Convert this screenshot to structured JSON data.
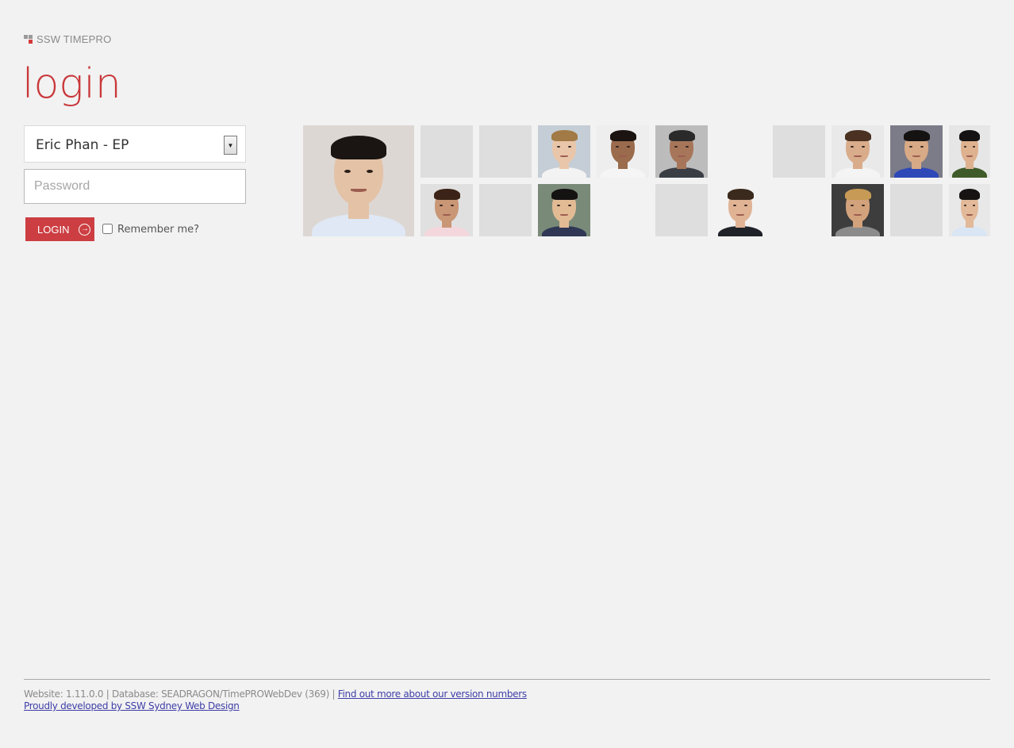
{
  "brand": {
    "name": "SSW TIMEPRO",
    "accent": "#c9383b"
  },
  "page": {
    "title": "login"
  },
  "form": {
    "user_select": {
      "selected": "Eric Phan - EP"
    },
    "password": {
      "placeholder": "Password",
      "value": ""
    },
    "login_button": {
      "label": "LOGIN",
      "icon": "arrow-circle-right-icon"
    },
    "remember": {
      "label": "Remember me?",
      "checked": false
    }
  },
  "avatars": [
    {
      "id": "featured",
      "kind": "photo",
      "skin": "#e4c2a6",
      "hair": "#1a1412",
      "shirt": "#dfe8f4",
      "bg": "#ddd7d4"
    },
    {
      "id": "r1c1",
      "kind": "empty"
    },
    {
      "id": "r1c2",
      "kind": "empty"
    },
    {
      "id": "r1c3",
      "kind": "photo",
      "skin": "#e9c6aa",
      "hair": "#a27a45",
      "shirt": "#f3f3f3",
      "bg": "#c5ced6"
    },
    {
      "id": "r1c4",
      "kind": "photo",
      "skin": "#9a6b4c",
      "hair": "#1c1410",
      "shirt": "#f5f5f5",
      "bg": "#eeeeee"
    },
    {
      "id": "r1c5",
      "kind": "photo",
      "skin": "#a7765a",
      "hair": "#2a2a2a",
      "shirt": "#3a3d44",
      "bg": "#bcbcbc"
    },
    {
      "id": "r1c7",
      "kind": "empty"
    },
    {
      "id": "r1c8",
      "kind": "photo",
      "skin": "#d9ac8c",
      "hair": "#4a3122",
      "shirt": "#f4f4f4",
      "bg": "#e9e9e9"
    },
    {
      "id": "r1c9",
      "kind": "photo",
      "skin": "#d8aa86",
      "hair": "#151212",
      "shirt": "#2e48b8",
      "bg": "#7c7c88"
    },
    {
      "id": "r1c10",
      "kind": "photo",
      "skin": "#deb18f",
      "hair": "#141212",
      "shirt": "#3f5b2a",
      "bg": "#e6e6e6"
    },
    {
      "id": "r2c1",
      "kind": "photo",
      "skin": "#c99676",
      "hair": "#3b2417",
      "shirt": "#f4d7dc",
      "bg": "#e0e0e0"
    },
    {
      "id": "r2c2",
      "kind": "empty"
    },
    {
      "id": "r2c3",
      "kind": "photo",
      "skin": "#e2bb95",
      "hair": "#151212",
      "shirt": "#2f3755",
      "bg": "#7a8a78"
    },
    {
      "id": "r2c5",
      "kind": "empty"
    },
    {
      "id": "r2c6",
      "kind": "photo",
      "skin": "#e0b395",
      "hair": "#3a2a1e",
      "shirt": "#1f2329",
      "bg": "#f2f2f2"
    },
    {
      "id": "r2c8",
      "kind": "photo",
      "skin": "#d2a27c",
      "hair": "#c79a55",
      "shirt": "#8b8b8b",
      "bg": "#3d3d3d"
    },
    {
      "id": "r2c9",
      "kind": "empty"
    },
    {
      "id": "r2c10",
      "kind": "photo",
      "skin": "#e2b999",
      "hair": "#171313",
      "shirt": "#dbe6f4",
      "bg": "#e8e8e8"
    }
  ],
  "footer": {
    "version_text": "Website: 1.11.0.0 | Database: SEADRAGON/TimePROWebDev (369) |",
    "version_link": "Find out more about our version numbers",
    "credit_link": "Proudly developed by SSW Sydney Web Design",
    "link_color": "#3e3ea8"
  }
}
